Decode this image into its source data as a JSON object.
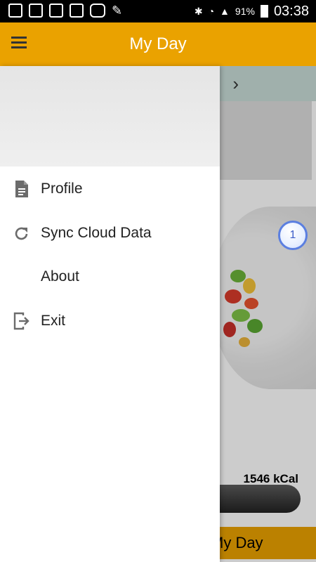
{
  "status_bar": {
    "battery": "91%",
    "time": "03:38",
    "icons": [
      "pinterest-icon",
      "gallery-icon",
      "amazon-icon",
      "amazon-icon",
      "youtube-icon",
      "pen-icon",
      "bluetooth-icon",
      "wifi-icon",
      "signal-icon",
      "battery-icon"
    ]
  },
  "app_bar": {
    "title": "My Day",
    "menu_icon": "hamburger-icon",
    "color": "#eaa200"
  },
  "drawer": {
    "items": [
      {
        "label": "Profile",
        "icon": "document-icon"
      },
      {
        "label": "Sync Cloud Data",
        "icon": "refresh-icon"
      },
      {
        "label": "About",
        "icon": ""
      },
      {
        "label": "Exit",
        "icon": "exit-icon"
      }
    ]
  },
  "background": {
    "calories": "1546 kCal",
    "bottom_button": "My Day",
    "badge_count": "1",
    "chevron_icon": "chevron-right-icon"
  }
}
